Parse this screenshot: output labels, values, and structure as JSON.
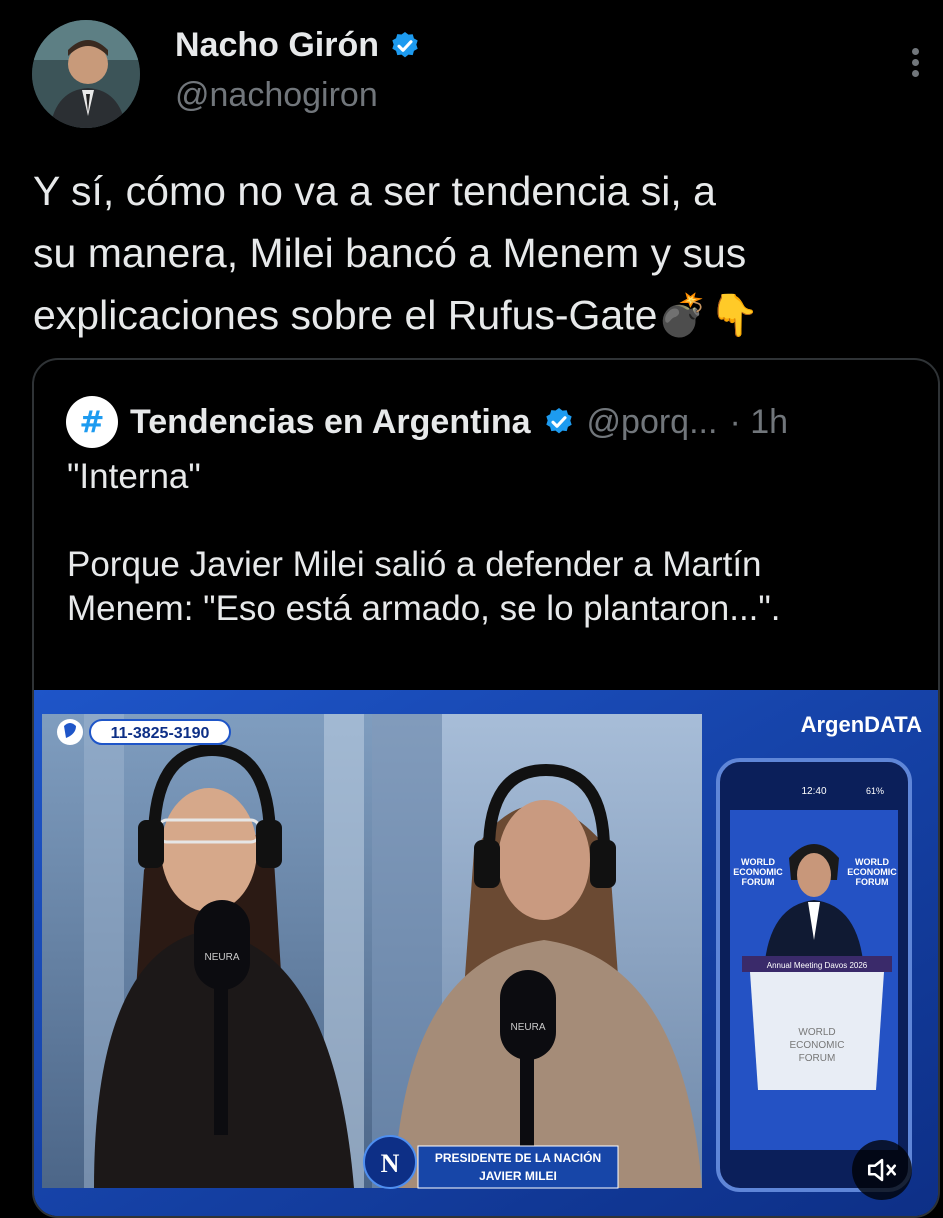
{
  "author": {
    "name": "Nacho Girón",
    "handle": "@nachogiron",
    "verified": true
  },
  "tweet": {
    "lines": [
      "Y sí, cómo no va a ser tendencia si, a",
      "su manera, Milei bancó a Menem y sus",
      "explicaciones sobre el Rufus-Gate💣👇"
    ]
  },
  "quote": {
    "avatar_glyph": "#",
    "name": "Tendencias en Argentina",
    "handle": "@porq...",
    "time": "· 1h",
    "title": "\"Interna\"",
    "body_lines": [
      "Porque Javier Milei salió a defender a Martín",
      "Menem: \"Eso está armado, se lo plantaron...\"."
    ]
  },
  "media": {
    "phone_number": "11-3825-3190",
    "brand": "ArgenDATA",
    "phone_time": "12:40",
    "phone_battery": "61%",
    "wef_label": [
      "WORLD",
      "ECONOMIC",
      "FORUM"
    ],
    "davos_banner": "Annual Meeting Davos 2026",
    "mic_brand": "NEURA",
    "network_logo": "N",
    "lower_third_title": "PRESIDENTE DE LA NACIÓN",
    "lower_third_name": "JAVIER MILEI",
    "mute_icon": "speaker-muted-icon"
  },
  "colors": {
    "verified_blue": "#1d9bf0",
    "text_primary": "#e7e9ea",
    "text_secondary": "#71767b",
    "border": "#2f3336",
    "broadcast_blue": "#1746a8"
  }
}
